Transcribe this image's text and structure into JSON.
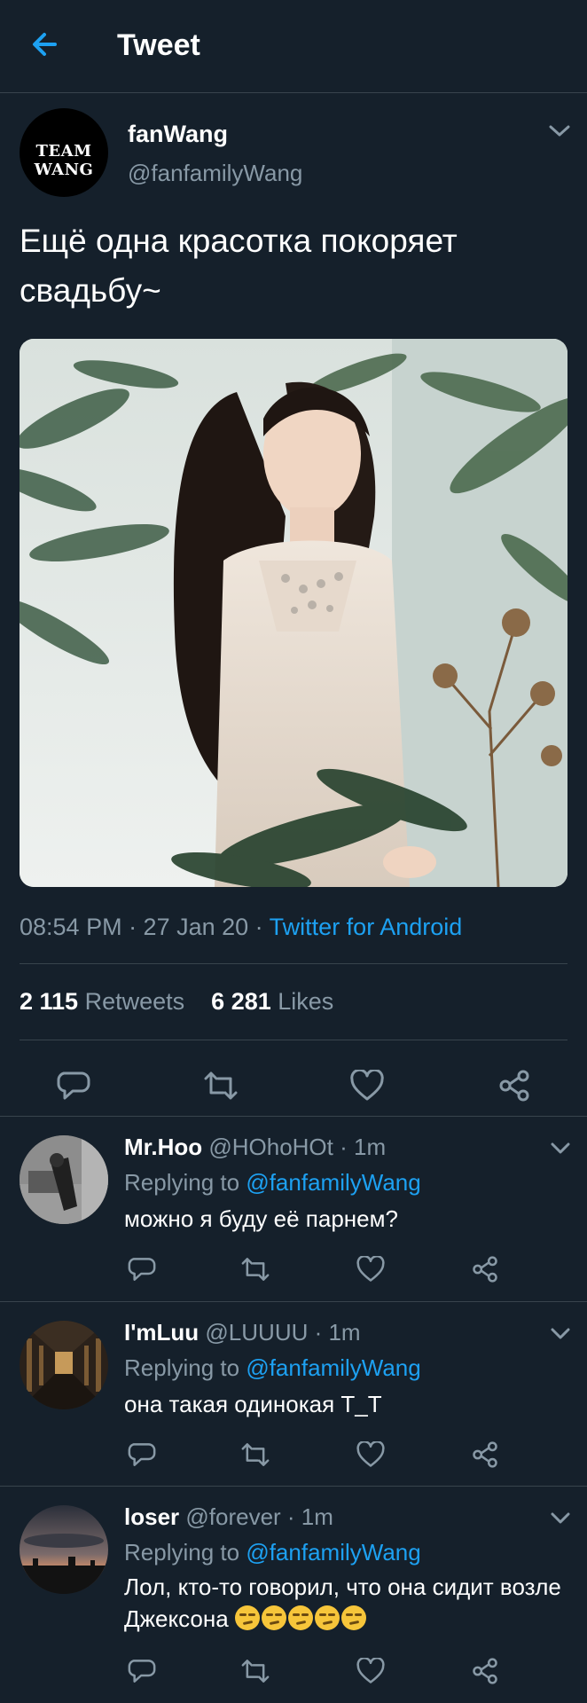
{
  "header": {
    "title": "Tweet"
  },
  "tweet": {
    "avatar_text": "TEAM WANG",
    "name": "fanWang",
    "handle": "@fanfamilyWang",
    "text": "Ещё одна красотка покоряет свадьбу~",
    "time": "08:54 PM · 27 Jan 20 · ",
    "source": "Twitter for Android",
    "retweets_count": "2 115",
    "retweets_label": "Retweets",
    "likes_count": "6 281",
    "likes_label": "Likes"
  },
  "icons": {
    "back": "arrow-left-icon",
    "reply": "reply-icon",
    "retweet": "retweet-icon",
    "like": "heart-icon",
    "share": "share-icon",
    "chevron": "chevron-down-icon"
  },
  "replies": [
    {
      "name": "Mr.Hoo",
      "handle": "@HOhoHOt · 1m",
      "replying_prefix": "Replying to ",
      "replying_to": "@fanfamilyWang",
      "text": "можно я буду её парнем?"
    },
    {
      "name": "I'mLuu",
      "handle": "@LUUUU · 1m",
      "replying_prefix": "Replying to ",
      "replying_to": "@fanfamilyWang",
      "text": "она такая одинокая T_T"
    },
    {
      "name": "loser",
      "handle": "@forever · 1m",
      "replying_prefix": "Replying to ",
      "replying_to": "@fanfamilyWang",
      "text": "Лол, кто-то говорил, что она сидит возле Джексона"
    }
  ],
  "colors": {
    "background": "#15202b",
    "accent": "#1da1f2",
    "muted": "#8899a6",
    "divider": "#38444d"
  }
}
